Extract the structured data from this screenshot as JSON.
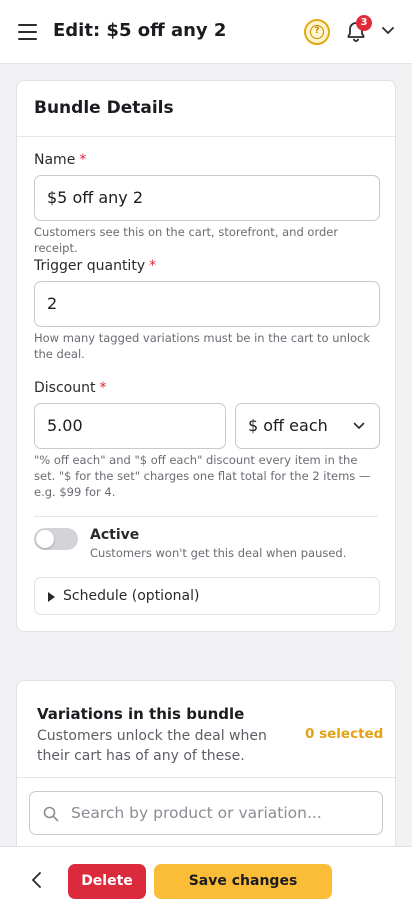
{
  "header": {
    "title": "Edit: $5 off any 2",
    "notification_count": "3",
    "icons": [
      "hamburger-menu-icon",
      "help-icon",
      "bell-icon",
      "chevron-down-icon"
    ],
    "help_glyph": "?"
  },
  "details": {
    "title": "Bundle Details",
    "name": {
      "label": "Name",
      "required_mark": "*",
      "value": "$5 off any 2",
      "help": "Customers see this on the cart, storefront, and order receipt."
    },
    "trigger": {
      "label": "Trigger quantity",
      "required_mark": "*",
      "value": "2",
      "help": "How many tagged variations must be in the cart to unlock the deal."
    },
    "discount": {
      "label": "Discount",
      "required_mark": "*",
      "value": "5.00",
      "type_selected": "$ off each",
      "help": "\"% off each\" and \"$ off each\" discount every item in the set. \"$ for the set\" charges one flat total for the 2 items — e.g. $99 for 4."
    },
    "active": {
      "label": "Active",
      "on": false,
      "help": "Customers won't get this deal when paused."
    },
    "schedule": {
      "label": "Schedule (optional)"
    }
  },
  "variations": {
    "title": "Variations in this bundle",
    "subtitle": "Customers unlock the deal when their cart has of any of these.",
    "selected_count": "0 selected",
    "search_placeholder": "Search by product or variation..."
  },
  "actions": {
    "delete_label": "Delete",
    "save_label": "Save changes"
  },
  "colors": {
    "accent": "#fbbd38",
    "danger": "#dc2a3d",
    "required": "#d92c3a",
    "count": "#e3a116"
  }
}
